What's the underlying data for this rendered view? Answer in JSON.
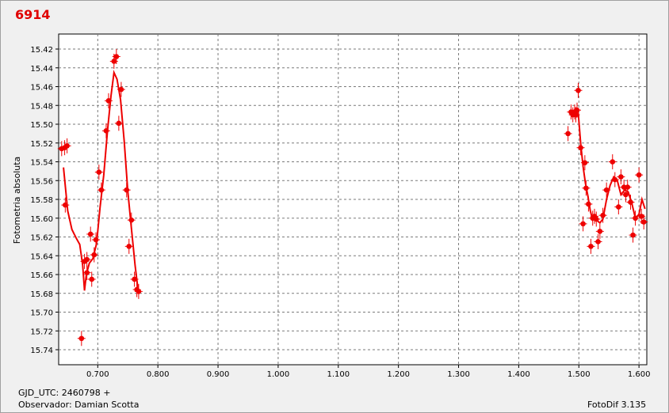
{
  "window": {
    "title": "6914"
  },
  "footer": {
    "jd_label": "GJD_UTC: 2460798 +",
    "observer_label": "Observador: Damian Scotta",
    "software": "FotoDif 3.135"
  },
  "colors": {
    "series": "#ee0000",
    "grid": "#7a7a7a",
    "background": "#ffffff"
  },
  "chart_data": {
    "type": "scatter",
    "title": "",
    "xlabel": "",
    "ylabel": "Fotometria absoluta",
    "xlim": [
      0.635,
      1.613
    ],
    "ylim": [
      15.756,
      15.404
    ],
    "y_inverted": true,
    "grid": true,
    "x_ticks": [
      0.7,
      0.8,
      0.9,
      1.0,
      1.1,
      1.2,
      1.3,
      1.4,
      1.5,
      1.6
    ],
    "x_tick_labels": [
      "0.700",
      "0.800",
      "0.900",
      "1.000",
      "1.100",
      "1.200",
      "1.300",
      "1.400",
      "1.500",
      "1.600"
    ],
    "y_ticks": [
      15.42,
      15.44,
      15.46,
      15.48,
      15.5,
      15.52,
      15.54,
      15.56,
      15.58,
      15.6,
      15.62,
      15.64,
      15.66,
      15.68,
      15.7,
      15.72,
      15.74
    ],
    "y_tick_labels": [
      "15.42",
      "15.44",
      "15.46",
      "15.48",
      "15.50",
      "15.52",
      "15.54",
      "15.56",
      "15.58",
      "15.60",
      "15.62",
      "15.64",
      "15.66",
      "15.68",
      "15.70",
      "15.72",
      "15.74"
    ],
    "series": [
      {
        "points": [
          [
            0.64,
            15.526
          ],
          [
            0.645,
            15.525
          ],
          [
            0.649,
            15.523
          ],
          [
            0.646,
            15.586
          ],
          [
            0.673,
            15.728
          ],
          [
            0.678,
            15.646
          ],
          [
            0.682,
            15.644
          ],
          [
            0.682,
            15.658
          ],
          [
            0.688,
            15.617
          ],
          [
            0.69,
            15.665
          ],
          [
            0.694,
            15.639
          ],
          [
            0.697,
            15.623
          ],
          [
            0.702,
            15.551
          ],
          [
            0.706,
            15.57
          ],
          [
            0.714,
            15.507
          ],
          [
            0.718,
            15.475
          ],
          [
            0.727,
            15.433
          ],
          [
            0.731,
            15.428
          ],
          [
            0.735,
            15.499
          ],
          [
            0.739,
            15.463
          ],
          [
            0.748,
            15.57
          ],
          [
            0.752,
            15.63
          ],
          [
            0.756,
            15.602
          ],
          [
            0.761,
            15.665
          ],
          [
            0.765,
            15.676
          ],
          [
            0.768,
            15.678
          ],
          [
            1.482,
            15.51
          ],
          [
            1.487,
            15.487
          ],
          [
            1.49,
            15.49
          ],
          [
            1.493,
            15.487
          ],
          [
            1.495,
            15.49
          ],
          [
            1.497,
            15.485
          ],
          [
            1.499,
            15.464
          ],
          [
            1.503,
            15.525
          ],
          [
            1.507,
            15.606
          ],
          [
            1.51,
            15.541
          ],
          [
            1.512,
            15.568
          ],
          [
            1.516,
            15.585
          ],
          [
            1.52,
            15.63
          ],
          [
            1.523,
            15.6
          ],
          [
            1.526,
            15.598
          ],
          [
            1.529,
            15.601
          ],
          [
            1.532,
            15.625
          ],
          [
            1.535,
            15.614
          ],
          [
            1.54,
            15.597
          ],
          [
            1.546,
            15.57
          ],
          [
            1.556,
            15.54
          ],
          [
            1.56,
            15.559
          ],
          [
            1.566,
            15.588
          ],
          [
            1.57,
            15.556
          ],
          [
            1.575,
            15.567
          ],
          [
            1.578,
            15.575
          ],
          [
            1.581,
            15.567
          ],
          [
            1.586,
            15.583
          ],
          [
            1.59,
            15.618
          ],
          [
            1.594,
            15.6
          ],
          [
            1.6,
            15.554
          ],
          [
            1.604,
            15.598
          ],
          [
            1.608,
            15.604
          ]
        ]
      }
    ],
    "fit_line": [
      [
        0.643,
        15.546
      ],
      [
        0.65,
        15.592
      ],
      [
        0.657,
        15.612
      ],
      [
        0.664,
        15.621
      ],
      [
        0.67,
        15.628
      ],
      [
        0.675,
        15.65
      ],
      [
        0.678,
        15.677
      ],
      [
        0.681,
        15.66
      ],
      [
        0.686,
        15.648
      ],
      [
        0.692,
        15.643
      ],
      [
        0.698,
        15.627
      ],
      [
        0.704,
        15.588
      ],
      [
        0.71,
        15.554
      ],
      [
        0.716,
        15.508
      ],
      [
        0.722,
        15.47
      ],
      [
        0.727,
        15.445
      ],
      [
        0.732,
        15.452
      ],
      [
        0.738,
        15.474
      ],
      [
        0.744,
        15.518
      ],
      [
        0.75,
        15.571
      ],
      [
        0.756,
        15.611
      ],
      [
        0.762,
        15.65
      ],
      [
        0.767,
        15.676
      ],
      [
        1.485,
        15.49
      ],
      [
        1.49,
        15.487
      ],
      [
        1.495,
        15.483
      ],
      [
        1.499,
        15.488
      ],
      [
        1.503,
        15.52
      ],
      [
        1.507,
        15.545
      ],
      [
        1.511,
        15.563
      ],
      [
        1.515,
        15.576
      ],
      [
        1.519,
        15.592
      ],
      [
        1.523,
        15.602
      ],
      [
        1.527,
        15.599
      ],
      [
        1.531,
        15.603
      ],
      [
        1.535,
        15.605
      ],
      [
        1.54,
        15.601
      ],
      [
        1.546,
        15.58
      ],
      [
        1.552,
        15.565
      ],
      [
        1.558,
        15.556
      ],
      [
        1.564,
        15.56
      ],
      [
        1.57,
        15.575
      ],
      [
        1.576,
        15.57
      ],
      [
        1.582,
        15.572
      ],
      [
        1.588,
        15.584
      ],
      [
        1.594,
        15.6
      ],
      [
        1.6,
        15.596
      ],
      [
        1.605,
        15.58
      ],
      [
        1.61,
        15.59
      ]
    ],
    "error_bar": 0.008
  }
}
